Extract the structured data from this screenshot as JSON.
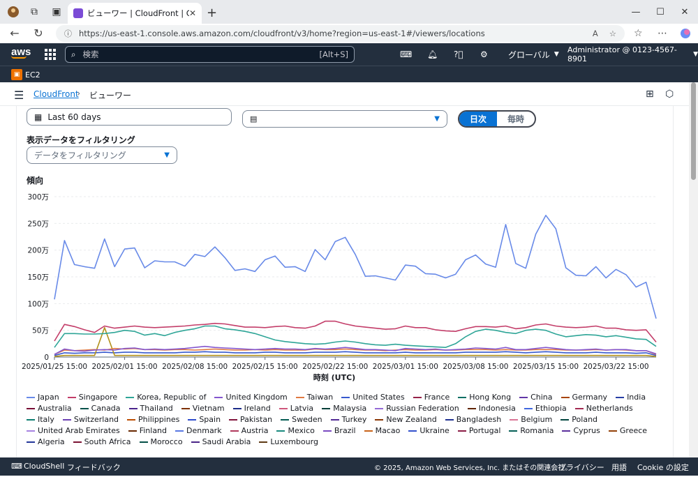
{
  "browser": {
    "tab_title": "ビューワー | CloudFront | Global",
    "url": "https://us-east-1.console.aws.amazon.com/cloudfront/v3/home?region=us-east-1#/viewers/locations"
  },
  "aws_header": {
    "logo": "aws",
    "search_placeholder": "検索",
    "search_shortcut": "[Alt+S]",
    "region": "グローバル",
    "account": "Administrator @ 0123-4567-8901",
    "service_shortcut": "EC2"
  },
  "breadcrumb": {
    "parent": "CloudFront",
    "current": "ビューワー"
  },
  "controls": {
    "date_range": "Last 60 days",
    "seg_daily": "日次",
    "seg_hourly": "毎時",
    "filter_label": "表示データをフィルタリング",
    "filter_placeholder": "データをフィルタリング",
    "trend_title": "傾向"
  },
  "chart_data": {
    "type": "line",
    "xlabel": "時刻 (UTC)",
    "ylabel": "",
    "ylim": [
      0,
      3000000
    ],
    "y_ticks": [
      "0",
      "50万",
      "100万",
      "150万",
      "200万",
      "250万",
      "300万"
    ],
    "x_ticks": [
      "2025/01/25 15:00",
      "2025/02/01 15:00",
      "2025/02/08 15:00",
      "2025/02/15 15:00",
      "2025/02/22 15:00",
      "2025/03/01 15:00",
      "2025/03/08 15:00",
      "2025/03/15 15:00",
      "2025/03/22 15:00"
    ],
    "series": [
      {
        "name": "Japan",
        "color": "#688ae8",
        "values": [
          108,
          218,
          173,
          169,
          166,
          221,
          169,
          202,
          204,
          167,
          180,
          178,
          178,
          170,
          192,
          188,
          206,
          186,
          162,
          165,
          160,
          182,
          189,
          168,
          169,
          160,
          201,
          182,
          216,
          224,
          192,
          151,
          152,
          148,
          144,
          172,
          170,
          156,
          155,
          148,
          155,
          182,
          191,
          174,
          168,
          248,
          175,
          166,
          230,
          265,
          240,
          167,
          153,
          152,
          169,
          148,
          164,
          154,
          131,
          140,
          72
        ]
      },
      {
        "name": "Singapore",
        "color": "#c33d69",
        "values": [
          30,
          61,
          57,
          51,
          46,
          58,
          54,
          56,
          58,
          56,
          55,
          56,
          57,
          58,
          60,
          61,
          63,
          62,
          59,
          56,
          56,
          55,
          57,
          58,
          55,
          54,
          58,
          67,
          67,
          62,
          58,
          56,
          54,
          52,
          53,
          58,
          55,
          55,
          51,
          49,
          48,
          53,
          57,
          57,
          56,
          58,
          53,
          55,
          60,
          62,
          58,
          56,
          55,
          56,
          58,
          54,
          54,
          51,
          50,
          51,
          28
        ]
      },
      {
        "name": "Korea, Republic of",
        "color": "#2ea597",
        "values": [
          18,
          44,
          44,
          43,
          43,
          44,
          46,
          50,
          48,
          41,
          44,
          40,
          46,
          50,
          53,
          58,
          58,
          53,
          51,
          48,
          44,
          38,
          32,
          29,
          27,
          25,
          24,
          25,
          28,
          30,
          28,
          25,
          23,
          22,
          24,
          22,
          21,
          20,
          19,
          18,
          25,
          38,
          48,
          52,
          50,
          46,
          44,
          50,
          52,
          50,
          43,
          38,
          40,
          42,
          41,
          38,
          40,
          37,
          34,
          33,
          20
        ]
      },
      {
        "name": "United Kingdom",
        "color": "#8456ce",
        "values": [
          5,
          15,
          12,
          11,
          13,
          14,
          13,
          16,
          17,
          14,
          15,
          14,
          15,
          16,
          18,
          20,
          18,
          17,
          16,
          15,
          14,
          15,
          16,
          15,
          15,
          14,
          16,
          15,
          16,
          18,
          16,
          14,
          14,
          13,
          12,
          16,
          15,
          14,
          15,
          13,
          14,
          15,
          17,
          16,
          15,
          18,
          14,
          14,
          16,
          18,
          16,
          14,
          13,
          14,
          15,
          13,
          14,
          14,
          12,
          12,
          6
        ]
      },
      {
        "name": "Taiwan",
        "color": "#e07941",
        "values": [
          5,
          13,
          12,
          13,
          14,
          13,
          16,
          15,
          16,
          14,
          14,
          13,
          14,
          14,
          13,
          14,
          15,
          14,
          13,
          13,
          14,
          13,
          14,
          13,
          13,
          13,
          15,
          14,
          14,
          15,
          14,
          13,
          13,
          12,
          13,
          14,
          13,
          13,
          14,
          13,
          13,
          14,
          14,
          14,
          13,
          14,
          13,
          13,
          14,
          14,
          14,
          13,
          13,
          13,
          14,
          13,
          14,
          13,
          12,
          12,
          5
        ]
      },
      {
        "name": "Vietnam",
        "color": "#b2911c",
        "values": [
          1,
          3,
          3,
          3,
          3,
          55,
          3,
          3,
          3,
          3,
          3,
          3,
          3,
          3,
          3,
          3,
          3,
          3,
          3,
          3,
          3,
          3,
          3,
          3,
          3,
          3,
          3,
          3,
          3,
          3,
          3,
          3,
          3,
          3,
          3,
          3,
          3,
          3,
          3,
          3,
          3,
          3,
          3,
          3,
          3,
          3,
          3,
          3,
          3,
          3,
          3,
          3,
          3,
          3,
          3,
          3,
          3,
          3,
          3,
          3,
          1
        ]
      },
      {
        "name": "United States",
        "color": "#3759ce",
        "values": [
          3,
          8,
          7,
          8,
          8,
          9,
          8,
          9,
          9,
          8,
          8,
          8,
          8,
          9,
          9,
          10,
          9,
          9,
          8,
          8,
          8,
          9,
          9,
          8,
          8,
          8,
          9,
          9,
          9,
          10,
          9,
          8,
          8,
          8,
          8,
          9,
          8,
          8,
          8,
          8,
          8,
          9,
          9,
          9,
          9,
          10,
          9,
          8,
          9,
          10,
          9,
          8,
          8,
          8,
          9,
          8,
          8,
          8,
          7,
          8,
          3
        ]
      }
    ],
    "legend": [
      "Japan",
      "Singapore",
      "Korea, Republic of",
      "United Kingdom",
      "Taiwan",
      "United States",
      "France",
      "Hong Kong",
      "China",
      "Germany",
      "India",
      "Australia",
      "Canada",
      "Thailand",
      "Vietnam",
      "Ireland",
      "Latvia",
      "Malaysia",
      "Russian Federation",
      "Indonesia",
      "Ethiopia",
      "Netherlands",
      "Italy",
      "Switzerland",
      "Philippines",
      "Spain",
      "Pakistan",
      "Sweden",
      "Turkey",
      "New Zealand",
      "Bangladesh",
      "Belgium",
      "Poland",
      "United Arab Emirates",
      "Finland",
      "Denmark",
      "Austria",
      "Mexico",
      "Brazil",
      "Macao",
      "Ukraine",
      "Portugal",
      "Romania",
      "Cyprus",
      "Greece",
      "Algeria",
      "South Africa",
      "Morocco",
      "Saudi Arabia",
      "Luxembourg"
    ],
    "legend_colors": [
      "#688ae8",
      "#c33d69",
      "#2ea597",
      "#8456ce",
      "#e07941",
      "#3759ce",
      "#962249",
      "#096f64",
      "#6237a7",
      "#a84401",
      "#273ea5",
      "#780d35",
      "#03524a",
      "#4a238b",
      "#7e3103",
      "#1b2b88",
      "#ce567c",
      "#003e38",
      "#9469d6",
      "#602400",
      "#4066df",
      "#a32952",
      "#0d7d70",
      "#6b40b2",
      "#bc4d01",
      "#2c4bcc",
      "#81143b",
      "#045b52",
      "#512994",
      "#8a3603",
      "#1f3191",
      "#da7596",
      "#01443e",
      "#a783e1",
      "#692801",
      "#5978e3",
      "#b0395c",
      "#1a8a7f",
      "#7a4ac1",
      "#c86319",
      "#3351cc",
      "#8b1d45",
      "#066057",
      "#5b2f9c",
      "#934108",
      "#24379a",
      "#7b1233",
      "#045047",
      "#4a2587",
      "#5e3a14"
    ]
  },
  "footer": {
    "cloudshell": "CloudShell",
    "feedback": "フィードバック",
    "copyright": "© 2025, Amazon Web Services, Inc. またはその関連会社。",
    "privacy": "プライバシー",
    "terms": "用語",
    "cookie": "Cookie の設定"
  }
}
